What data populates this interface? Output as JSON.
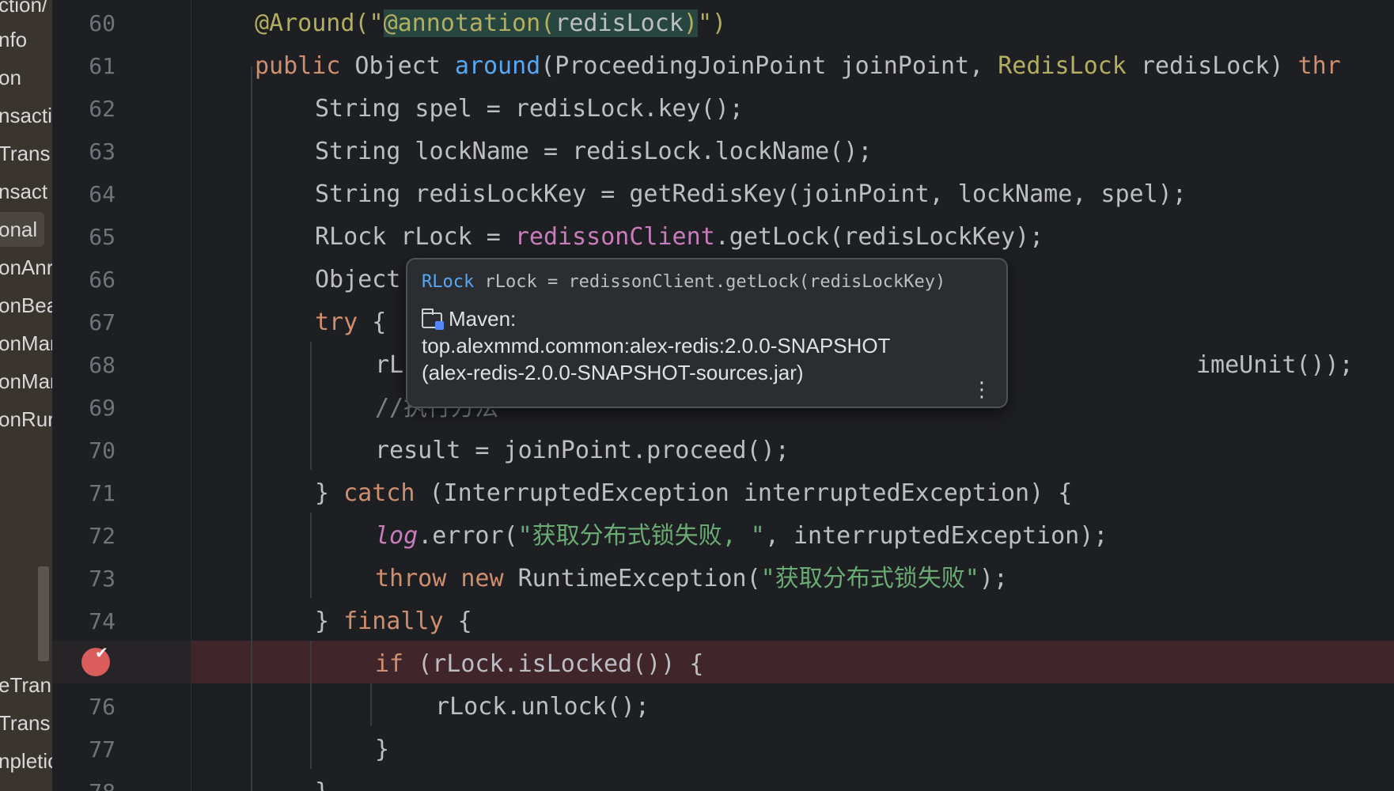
{
  "sidebar": {
    "items": [
      {
        "label": "ction/"
      },
      {
        "label": "nfo"
      },
      {
        "label": "on"
      },
      {
        "label": "nsacti"
      },
      {
        "label": "Trans"
      },
      {
        "label": "nsact"
      },
      {
        "label": "onal"
      },
      {
        "label": "onAnr"
      },
      {
        "label": "onBea"
      },
      {
        "label": "onMar"
      },
      {
        "label": "onMar"
      },
      {
        "label": "onRur"
      },
      {
        "label": "eTran"
      },
      {
        "label": "Trans"
      },
      {
        "label": "npletic"
      }
    ]
  },
  "editor": {
    "line_numbers": [
      "60",
      "61",
      "62",
      "63",
      "64",
      "65",
      "66",
      "67",
      "68",
      "69",
      "70",
      "71",
      "72",
      "73",
      "74",
      "",
      "76",
      "77",
      "78"
    ],
    "lines": {
      "l60": {
        "p1": "@Around(\"",
        "p2": "@annotation(",
        "p3": "redisLock",
        "p4": ")",
        "p5": "\")"
      },
      "l61": {
        "kw": "public",
        "t1": " Object ",
        "fn": "around",
        "t2": "(ProceedingJoinPoint joinPoint, ",
        "typ": "RedisLock",
        "t3": " redisLock) ",
        "kw2": "thr"
      },
      "l62": {
        "t": "String spel = redisLock.key();"
      },
      "l63": {
        "t": "String lockName = redisLock.lockName();"
      },
      "l64": {
        "t": "String redisLockKey = getRedisKey(joinPoint, lockName, spel);"
      },
      "l65": {
        "t1": "RLock rLock = ",
        "fld": "redissonClient",
        "t2": ".getLock(redisLockKey);"
      },
      "l66": {
        "t": "Object"
      },
      "l67": {
        "kw": "try",
        "t": " {"
      },
      "l68": {
        "t1": "rL",
        "t2": "imeUnit());"
      },
      "l69": {
        "cmt": "//执行方法"
      },
      "l70": {
        "t": "result = joinPoint.proceed();"
      },
      "l71": {
        "t1": "} ",
        "kw": "catch",
        "t2": " (InterruptedException interruptedException) {"
      },
      "l72": {
        "fld": "log",
        "t1": ".error(",
        "str": "\"获取分布式锁失败, \"",
        "t2": ", interruptedException);"
      },
      "l73": {
        "kw": "throw new",
        "t1": " RuntimeException(",
        "str": "\"获取分布式锁失败\"",
        "t2": ");"
      },
      "l74": {
        "t1": "} ",
        "kw": "finally",
        "t2": " {"
      },
      "l75": {
        "kw": "if",
        "t": " (rLock.isLocked()) {"
      },
      "l76": {
        "t": "rLock.unlock();"
      },
      "l77": {
        "t": "}"
      },
      "l78": {
        "t": "}"
      }
    }
  },
  "popup": {
    "sig_type": "RLock",
    "sig_rest": " rLock = redissonClient.getLock(redisLockKey)",
    "lib_label": "Maven:",
    "lib_coords": "top.alexmmd.common:alex-redis:2.0.0-SNAPSHOT",
    "lib_jar": "(alex-redis-2.0.0-SNAPSHOT-sources.jar)",
    "more_glyph": "⋮",
    "folder_icon": "library-folder-icon"
  },
  "colors": {
    "background": "#1e1f22",
    "keyword": "#cf8e6d",
    "function": "#56a8f5",
    "field": "#c77dbb",
    "string": "#6aab73",
    "annotation": "#b3ae60",
    "breakpoint": "#db5c5c",
    "breakpoint_line": "#40252b"
  },
  "gutter": {
    "breakpoint_check": "✔"
  }
}
